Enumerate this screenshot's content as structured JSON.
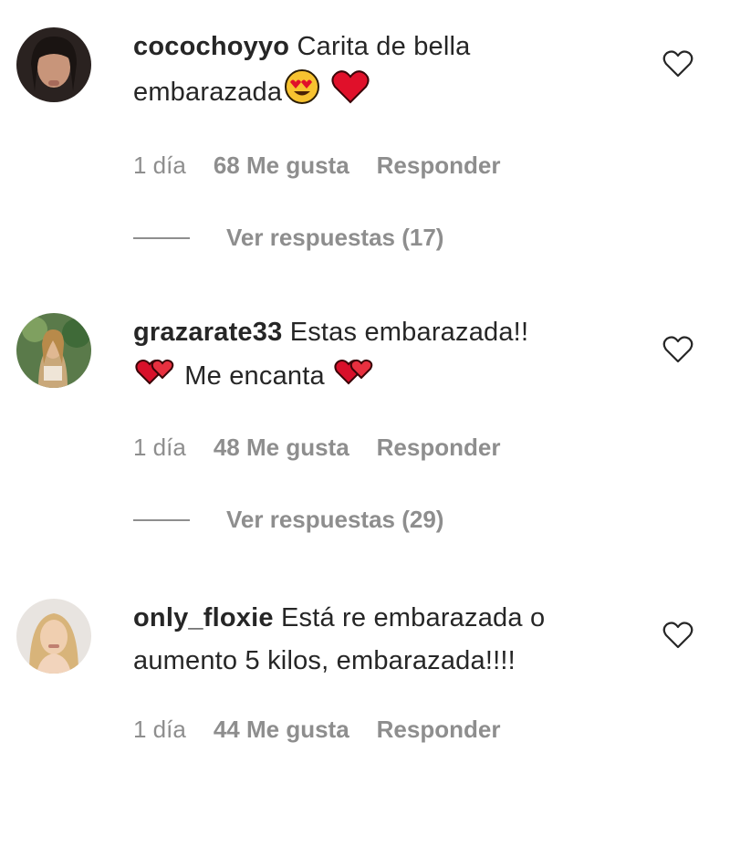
{
  "comments": [
    {
      "username": "cocochoyyo",
      "text_line1": "Carita de bella",
      "text_line2": "embarazada",
      "emojis": [
        "heart-eyes-emoji",
        "red-heart-emoji"
      ],
      "time": "1 día",
      "likes": "68 Me gusta",
      "reply": "Responder",
      "view_replies": "Ver respuestas (17)"
    },
    {
      "username": "grazarate33",
      "text_line1": "Estas embarazada!!",
      "text_line2": "Me encanta",
      "emojis": [
        "two-hearts-emoji",
        "two-hearts-emoji"
      ],
      "time": "1 día",
      "likes": "48 Me gusta",
      "reply": "Responder",
      "view_replies": "Ver respuestas (29)"
    },
    {
      "username": "only_floxie",
      "text_line1": "Está re embarazada o",
      "text_line2": "aumento 5 kilos, embarazada!!!!",
      "time": "1 día",
      "likes": "44 Me gusta",
      "reply": "Responder"
    }
  ],
  "colors": {
    "text": "#262626",
    "muted": "#8e8e8e",
    "heart_red": "#e0102a"
  },
  "icons": {
    "like": "heart-outline-icon"
  }
}
